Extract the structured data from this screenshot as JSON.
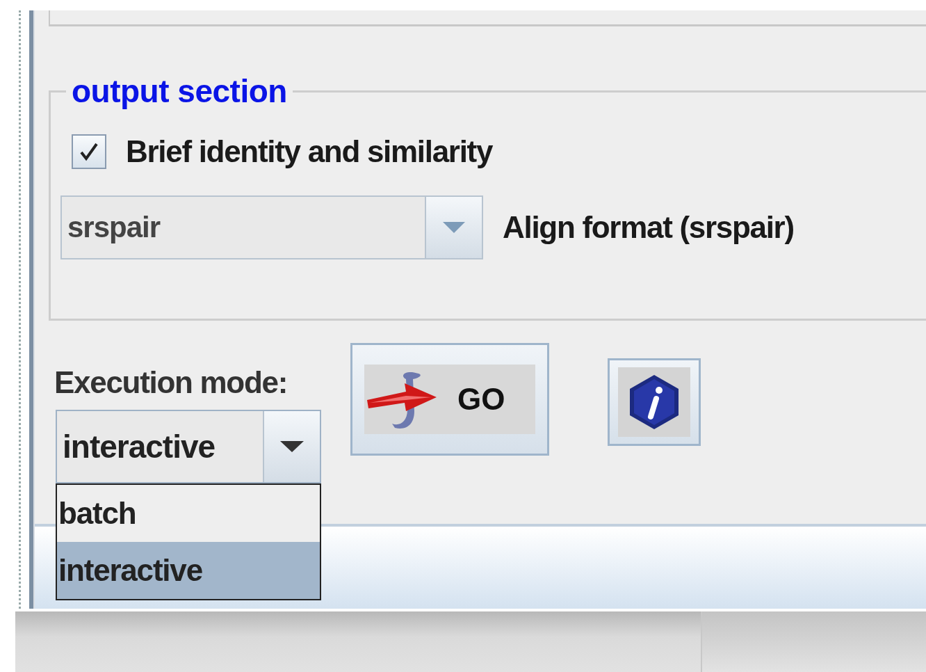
{
  "output_section": {
    "title": "output section",
    "checkbox": {
      "label": "Brief identity and similarity",
      "checked": true
    },
    "align_format": {
      "value": "srspair",
      "label": "Align format (srspair)"
    }
  },
  "execution": {
    "label": "Execution mode:",
    "value": "interactive",
    "expanded": true,
    "options": [
      {
        "label": "batch",
        "selected": false
      },
      {
        "label": "interactive",
        "selected": true
      }
    ]
  },
  "buttons": [
    {
      "kind": "go",
      "label": "GO"
    },
    {
      "kind": "info"
    }
  ]
}
